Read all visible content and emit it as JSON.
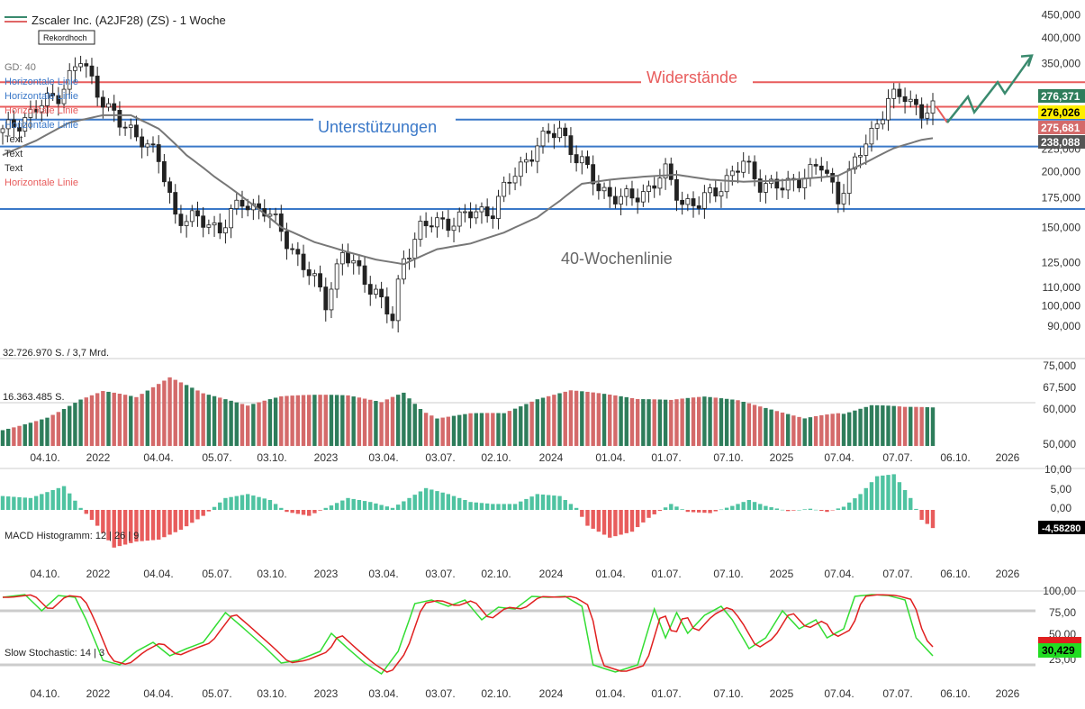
{
  "header": {
    "title": "Zscaler Inc. (A2JF28) (ZS) - 1 Woche",
    "badge": "Rekordhoch",
    "colors": {
      "title_line_green": "#3a8a6e",
      "title_line_red": "#e06666"
    }
  },
  "colors": {
    "up": "#2e7d5b",
    "down": "#d46a6a",
    "wick": "#222222",
    "resistance": "#e85c5c",
    "support": "#3a78c8",
    "ma": "#777777",
    "hist_pos": "#4fc3a1",
    "hist_neg": "#e85c5c",
    "stoch_k": "#33dd33",
    "stoch_d": "#e02020",
    "arrow": "#3a8a6e"
  },
  "legend_items": [
    {
      "label": "GD: 40",
      "color": "#777777"
    },
    {
      "label": "Horizontale Linie",
      "color": "#3a78c8"
    },
    {
      "label": "Horizontale Linie",
      "color": "#3a78c8"
    },
    {
      "label": "Horizontale Linie",
      "color": "#e85c5c"
    },
    {
      "label": "Horizontale Linie",
      "color": "#3a78c8"
    },
    {
      "label": "Text",
      "color": "#333333"
    },
    {
      "label": "Text",
      "color": "#333333"
    },
    {
      "label": "Text",
      "color": "#333333"
    },
    {
      "label": "Horizontale Linie",
      "color": "#e85c5c"
    }
  ],
  "annotations": {
    "resistance": "Widerstände",
    "support": "Unterstützungen",
    "ma_label": "40-Wochenlinie"
  },
  "value_badges": [
    {
      "value": "276,371",
      "bg": "#2e7d5b",
      "fg": "#ffffff"
    },
    {
      "value": "276,026",
      "bg": "#ffee00",
      "fg": "#000000"
    },
    {
      "value": "275,681",
      "bg": "#d46a6a",
      "fg": "#ffffff"
    },
    {
      "value": "238,088",
      "bg": "#555555",
      "fg": "#ffffff"
    }
  ],
  "volume": {
    "label_top": "32.726.970 S. / 3,7 Mrd.",
    "label_mid": "16.363.485 S."
  },
  "macd": {
    "label": "MACD Histogramm: 12 | 26 | 9",
    "value_badge": "-4,58280",
    "ticks": [
      "10,00",
      "5,00",
      "0,00"
    ]
  },
  "stochastic": {
    "label": "Slow Stochastic: 14 | 3",
    "value_badge": "30,429",
    "ticks": [
      "100,00",
      "75,00",
      "50,00",
      "25,00"
    ]
  },
  "chart_data": [
    {
      "type": "candlestick",
      "title": "Zscaler Inc. (A2JF28) (ZS) - 1 Woche",
      "scale": "log",
      "ylim": [
        82000,
        460000
      ],
      "y_ticks": [
        450000,
        400000,
        350000,
        300000,
        250000,
        225000,
        200000,
        175000,
        150000,
        125000,
        110000,
        100000,
        90000
      ],
      "y_tick_labels": [
        "450,000",
        "400,000",
        "350,000",
        "300,000",
        "250,000",
        "225,000",
        "200,000",
        "175,000",
        "150,000",
        "125,000",
        "110,000",
        "100,000",
        "90,000"
      ],
      "x_labels": [
        "04.10.",
        "2022",
        "04.04.",
        "05.07.",
        "03.10.",
        "2023",
        "03.04.",
        "03.07.",
        "02.10.",
        "2024",
        "01.04.",
        "01.07.",
        "07.10.",
        "2025",
        "07.04.",
        "07.07.",
        "06.10.",
        "2026"
      ],
      "horizontal_lines": [
        {
          "value": 318000,
          "color": "#e85c5c",
          "label": "Widerstände"
        },
        {
          "value": 280000,
          "color": "#e85c5c"
        },
        {
          "value": 262000,
          "color": "#3a78c8",
          "label": "Unterstützungen"
        },
        {
          "value": 228000,
          "color": "#3a78c8"
        },
        {
          "value": 165000,
          "color": "#3a78c8"
        }
      ],
      "close_anchors": [
        [
          0,
          245000
        ],
        [
          5,
          270000
        ],
        [
          10,
          300000
        ],
        [
          14,
          355000
        ],
        [
          16,
          320000
        ],
        [
          19,
          278000
        ],
        [
          21,
          255000
        ],
        [
          25,
          240000
        ],
        [
          28,
          210000
        ],
        [
          31,
          160000
        ],
        [
          35,
          155000
        ],
        [
          39,
          150000
        ],
        [
          43,
          170000
        ],
        [
          47,
          165000
        ],
        [
          51,
          140000
        ],
        [
          55,
          118000
        ],
        [
          58,
          102000
        ],
        [
          61,
          132000
        ],
        [
          64,
          118000
        ],
        [
          67,
          108000
        ],
        [
          70,
          92000
        ],
        [
          72,
          128000
        ],
        [
          75,
          150000
        ],
        [
          80,
          155000
        ],
        [
          84,
          160000
        ],
        [
          88,
          165000
        ],
        [
          92,
          198000
        ],
        [
          96,
          230000
        ],
        [
          100,
          250000
        ],
        [
          103,
          215000
        ],
        [
          107,
          185000
        ],
        [
          111,
          172000
        ],
        [
          115,
          180000
        ],
        [
          119,
          198000
        ],
        [
          122,
          172000
        ],
        [
          125,
          168000
        ],
        [
          129,
          188000
        ],
        [
          133,
          208000
        ],
        [
          136,
          190000
        ],
        [
          140,
          183000
        ],
        [
          144,
          198000
        ],
        [
          147,
          205000
        ],
        [
          150,
          176000
        ],
        [
          153,
          208000
        ],
        [
          156,
          245000
        ],
        [
          159,
          290000
        ],
        [
          162,
          295000
        ],
        [
          165,
          275000
        ],
        [
          167,
          275000
        ]
      ],
      "ma40_anchors": [
        [
          0,
          218000
        ],
        [
          6,
          235000
        ],
        [
          12,
          258000
        ],
        [
          18,
          268000
        ],
        [
          23,
          268000
        ],
        [
          28,
          250000
        ],
        [
          33,
          218000
        ],
        [
          38,
          195000
        ],
        [
          44,
          172000
        ],
        [
          50,
          150000
        ],
        [
          56,
          139000
        ],
        [
          62,
          132000
        ],
        [
          67,
          127000
        ],
        [
          72,
          124000
        ],
        [
          78,
          134000
        ],
        [
          84,
          138000
        ],
        [
          90,
          146000
        ],
        [
          96,
          158000
        ],
        [
          100,
          172000
        ],
        [
          104,
          188000
        ],
        [
          109,
          192000
        ],
        [
          115,
          195000
        ],
        [
          121,
          197000
        ],
        [
          127,
          192000
        ],
        [
          133,
          190000
        ],
        [
          139,
          191000
        ],
        [
          144,
          193000
        ],
        [
          150,
          196000
        ],
        [
          155,
          210000
        ],
        [
          160,
          226000
        ],
        [
          165,
          236000
        ],
        [
          167,
          238000
        ]
      ],
      "volume_anchors": [
        [
          0,
          0.25
        ],
        [
          8,
          0.35
        ],
        [
          14,
          0.5
        ],
        [
          18,
          0.55
        ],
        [
          24,
          0.45
        ],
        [
          30,
          0.6
        ],
        [
          36,
          0.45
        ],
        [
          44,
          0.35
        ],
        [
          50,
          0.45
        ],
        [
          56,
          0.5
        ],
        [
          62,
          0.55
        ],
        [
          68,
          0.55
        ],
        [
          72,
          0.75
        ],
        [
          78,
          0.4
        ],
        [
          84,
          0.4
        ],
        [
          90,
          0.35
        ],
        [
          96,
          0.45
        ],
        [
          102,
          0.5
        ],
        [
          108,
          0.45
        ],
        [
          114,
          0.4
        ],
        [
          120,
          0.4
        ],
        [
          126,
          0.45
        ],
        [
          132,
          0.45
        ],
        [
          138,
          0.4
        ],
        [
          144,
          0.35
        ],
        [
          150,
          0.5
        ],
        [
          156,
          0.55
        ],
        [
          162,
          0.45
        ],
        [
          167,
          0.4
        ]
      ],
      "macd_anchors": [
        [
          0,
          3.5
        ],
        [
          5,
          3.0
        ],
        [
          11,
          6.0
        ],
        [
          14,
          0.5
        ],
        [
          17,
          -4.0
        ],
        [
          20,
          -9.5
        ],
        [
          24,
          -8.0
        ],
        [
          28,
          -7.5
        ],
        [
          32,
          -5.0
        ],
        [
          36,
          -1.5
        ],
        [
          40,
          3.0
        ],
        [
          44,
          4.0
        ],
        [
          48,
          2.5
        ],
        [
          51,
          -0.5
        ],
        [
          55,
          -1.5
        ],
        [
          58,
          0.5
        ],
        [
          62,
          3.0
        ],
        [
          66,
          2.0
        ],
        [
          70,
          0.5
        ],
        [
          73,
          3.0
        ],
        [
          76,
          5.5
        ],
        [
          80,
          4.0
        ],
        [
          84,
          2.0
        ],
        [
          88,
          1.5
        ],
        [
          92,
          1.5
        ],
        [
          96,
          4.0
        ],
        [
          100,
          3.5
        ],
        [
          103,
          0.5
        ],
        [
          105,
          -4.0
        ],
        [
          109,
          -7.0
        ],
        [
          113,
          -5.5
        ],
        [
          116,
          -2.0
        ],
        [
          120,
          1.5
        ],
        [
          123,
          -0.5
        ],
        [
          127,
          -0.8
        ],
        [
          131,
          1.0
        ],
        [
          134,
          2.5
        ],
        [
          137,
          1.0
        ],
        [
          141,
          -0.3
        ],
        [
          145,
          0.3
        ],
        [
          148,
          -0.5
        ],
        [
          151,
          0.8
        ],
        [
          154,
          4.0
        ],
        [
          157,
          8.5
        ],
        [
          160,
          9.0
        ],
        [
          163,
          3.0
        ],
        [
          165,
          -2.5
        ],
        [
          167,
          -4.58
        ]
      ],
      "stoch_k_anchors": [
        [
          0,
          95
        ],
        [
          4,
          98
        ],
        [
          7,
          80
        ],
        [
          10,
          97
        ],
        [
          13,
          95
        ],
        [
          15,
          70
        ],
        [
          18,
          25
        ],
        [
          21,
          20
        ],
        [
          24,
          35
        ],
        [
          27,
          45
        ],
        [
          30,
          30
        ],
        [
          33,
          38
        ],
        [
          36,
          45
        ],
        [
          40,
          78
        ],
        [
          43,
          62
        ],
        [
          47,
          40
        ],
        [
          50,
          22
        ],
        [
          53,
          25
        ],
        [
          57,
          35
        ],
        [
          59,
          55
        ],
        [
          62,
          38
        ],
        [
          65,
          22
        ],
        [
          68,
          10
        ],
        [
          71,
          35
        ],
        [
          74,
          88
        ],
        [
          77,
          92
        ],
        [
          80,
          85
        ],
        [
          83,
          92
        ],
        [
          86,
          70
        ],
        [
          89,
          84
        ],
        [
          92,
          82
        ],
        [
          95,
          96
        ],
        [
          98,
          95
        ],
        [
          101,
          96
        ],
        [
          104,
          85
        ],
        [
          106,
          20
        ],
        [
          110,
          12
        ],
        [
          114,
          20
        ],
        [
          117,
          82
        ],
        [
          119,
          50
        ],
        [
          121,
          78
        ],
        [
          123,
          55
        ],
        [
          126,
          75
        ],
        [
          129,
          85
        ],
        [
          131,
          70
        ],
        [
          134,
          38
        ],
        [
          137,
          50
        ],
        [
          140,
          80
        ],
        [
          143,
          60
        ],
        [
          146,
          70
        ],
        [
          148,
          50
        ],
        [
          151,
          60
        ],
        [
          153,
          96
        ],
        [
          156,
          98
        ],
        [
          159,
          97
        ],
        [
          162,
          92
        ],
        [
          164,
          50
        ],
        [
          167,
          30
        ]
      ],
      "projection": {
        "red": [
          [
            280000
          ],
          [
            255000
          ]
        ],
        "green_path": [
          258000,
          295000,
          272000,
          318000,
          300000,
          365000
        ]
      }
    }
  ]
}
